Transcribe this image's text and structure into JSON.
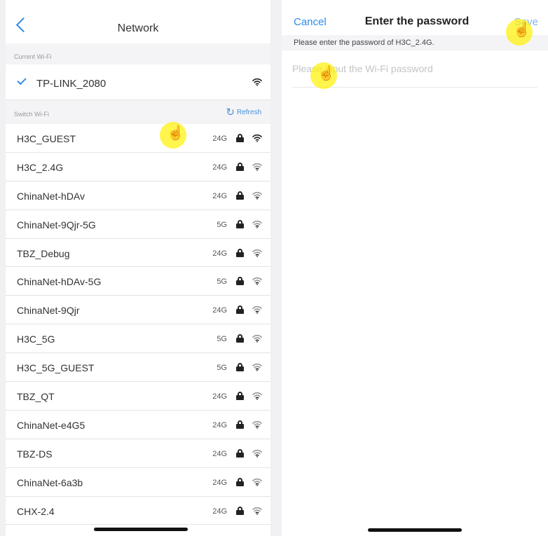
{
  "left": {
    "title": "Network",
    "current_section": "Current Wi-Fi",
    "current_network": "TP-LINK_2080",
    "switch_section": "Switch Wi-Fi",
    "refresh_label": "Refresh",
    "networks": [
      {
        "name": "H3C_GUEST",
        "band": "24G"
      },
      {
        "name": "H3C_2.4G",
        "band": "24G"
      },
      {
        "name": "ChinaNet-hDAv",
        "band": "24G"
      },
      {
        "name": "ChinaNet-9Qjr-5G",
        "band": "5G"
      },
      {
        "name": "TBZ_Debug",
        "band": "24G"
      },
      {
        "name": "ChinaNet-hDAv-5G",
        "band": "5G"
      },
      {
        "name": "ChinaNet-9Qjr",
        "band": "24G"
      },
      {
        "name": "H3C_5G",
        "band": "5G"
      },
      {
        "name": "H3C_5G_GUEST",
        "band": "5G"
      },
      {
        "name": "TBZ_QT",
        "band": "24G"
      },
      {
        "name": "ChinaNet-e4G5",
        "band": "24G"
      },
      {
        "name": "TBZ-DS",
        "band": "24G"
      },
      {
        "name": "ChinaNet-6a3b",
        "band": "24G"
      },
      {
        "name": "CHX-2.4",
        "band": "24G"
      }
    ]
  },
  "right": {
    "cancel_label": "Cancel",
    "title": "Enter the password",
    "save_label": "Save",
    "hint": "Please enter the password of H3C_2.4G.",
    "password_placeholder": "Please input the Wi-Fi password",
    "password_value": ""
  },
  "colors": {
    "accent": "#2e8ae6",
    "save_disabled": "#7fb6ee",
    "touch_marker": "#fff100"
  },
  "icons": {
    "back": "chevron-left-icon",
    "check": "checkmark-icon",
    "wifi": "wifi-icon",
    "lock": "lock-icon",
    "refresh": "refresh-icon",
    "touch": "hand-pointer-icon"
  }
}
